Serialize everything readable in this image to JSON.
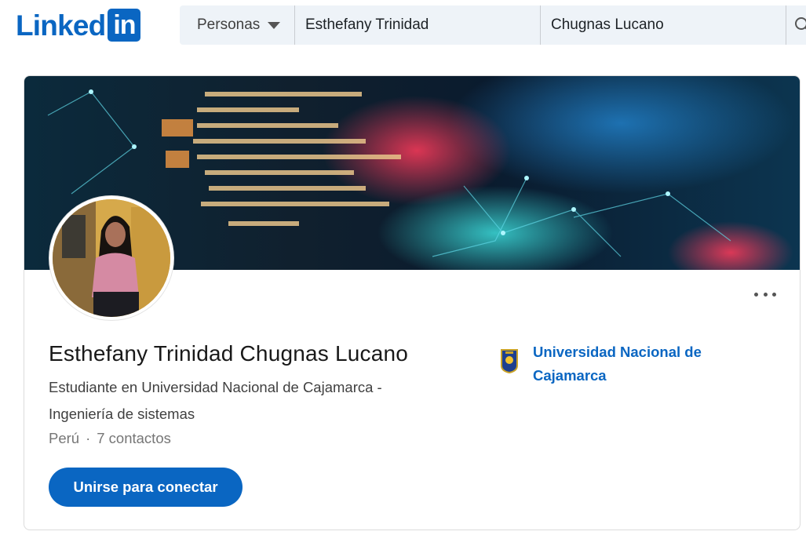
{
  "brand": {
    "logo_text": "Linked",
    "logo_box": "in",
    "color": "#0a66c2"
  },
  "search": {
    "filter_label": "Personas",
    "first_name": "Esthefany Trinidad",
    "last_name": "Chugnas Lucano",
    "icon": "search-icon"
  },
  "profile": {
    "name": "Esthefany Trinidad Chugnas Lucano",
    "headline": "Estudiante en Universidad Nacional de Cajamarca - Ingeniería de sistemas",
    "location": "Perú",
    "separator": "·",
    "connections": "7 contactos",
    "connect_label": "Unirse para conectar",
    "more_icon": "ellipsis-icon"
  },
  "education": {
    "school": "Universidad Nacional de Cajamarca",
    "logo_icon": "university-crest-icon"
  },
  "colors": {
    "accent": "#0a66c2",
    "search_bg": "#eef3f8",
    "text_secondary": "#767676"
  }
}
